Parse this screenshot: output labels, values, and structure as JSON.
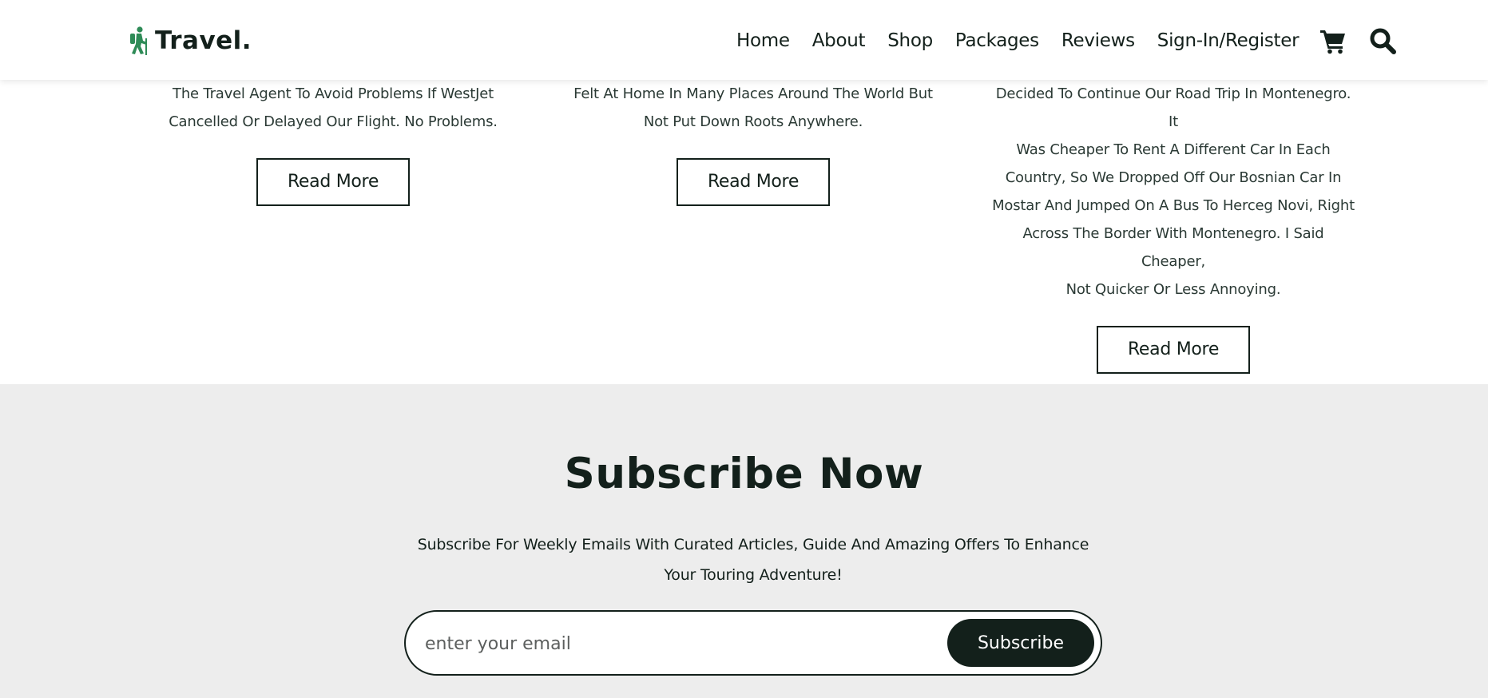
{
  "header": {
    "logo_text": "Travel.",
    "logo_icon": "hiker-icon",
    "nav": [
      "Home",
      "About",
      "Shop",
      "Packages",
      "Reviews",
      "Sign-In/Register"
    ],
    "icons": [
      "cart-icon",
      "search-icon"
    ]
  },
  "cards": [
    {
      "text_lines": [
        "The Travel Agent To Avoid Problems If WestJet",
        "Cancelled Or Delayed Our Flight. No Problems."
      ],
      "button": "Read More"
    },
    {
      "text_lines": [
        "Felt At Home In Many Places Around The World But",
        "Not Put Down Roots Anywhere."
      ],
      "button": "Read More"
    },
    {
      "text_lines": [
        "Decided To Continue Our Road Trip In Montenegro. It",
        "Was Cheaper To Rent A Different Car In Each",
        "Country, So We Dropped Off Our Bosnian Car In",
        "Mostar And Jumped On A Bus To Herceg Novi, Right",
        "Across The Border With Montenegro. I Said Cheaper,",
        "Not Quicker Or Less Annoying."
      ],
      "button": "Read More"
    }
  ],
  "subscribe": {
    "title": "Subscribe Now",
    "text_line1": "Subscribe For Weekly Emails With Curated Articles, Guide And Amazing Offers To Enhance",
    "text_line2": "Your Touring Adventure!",
    "placeholder": "enter your email",
    "button": "Subscribe"
  },
  "colors": {
    "accent": "#2e8b57",
    "dark": "#13201b",
    "section_bg": "#ededed"
  }
}
